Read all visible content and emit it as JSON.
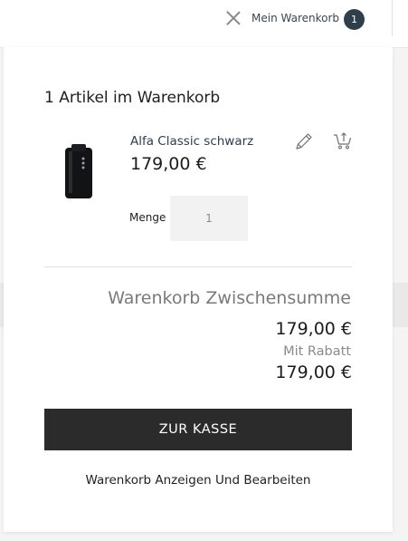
{
  "header": {
    "cart_label": "Mein Warenkorb",
    "cart_count": "1",
    "close_icon": "close-icon"
  },
  "minicart": {
    "title": "1 Artikel im Warenkorb",
    "item": {
      "name": "Alfa Classic schwarz",
      "price": "179,00 €",
      "qty_label": "Menge",
      "qty_value": "1",
      "edit_icon": "pencil-icon",
      "move_icon": "cart-move-icon"
    },
    "subtotal_label": "Warenkorb Zwischensumme",
    "subtotal_value": "179,00 €",
    "discount_label": "Mit Rabatt",
    "discount_value": "179,00 €",
    "checkout_label": "ZUR KASSE",
    "view_edit_label": "Warenkorb Anzeigen Und Bearbeiten"
  },
  "colors": {
    "header_badge": "#2f3e4b",
    "checkout_button": "#2b2b2b",
    "product_link": "#2d3e50",
    "subtotal_label": "#7a7a7a"
  }
}
